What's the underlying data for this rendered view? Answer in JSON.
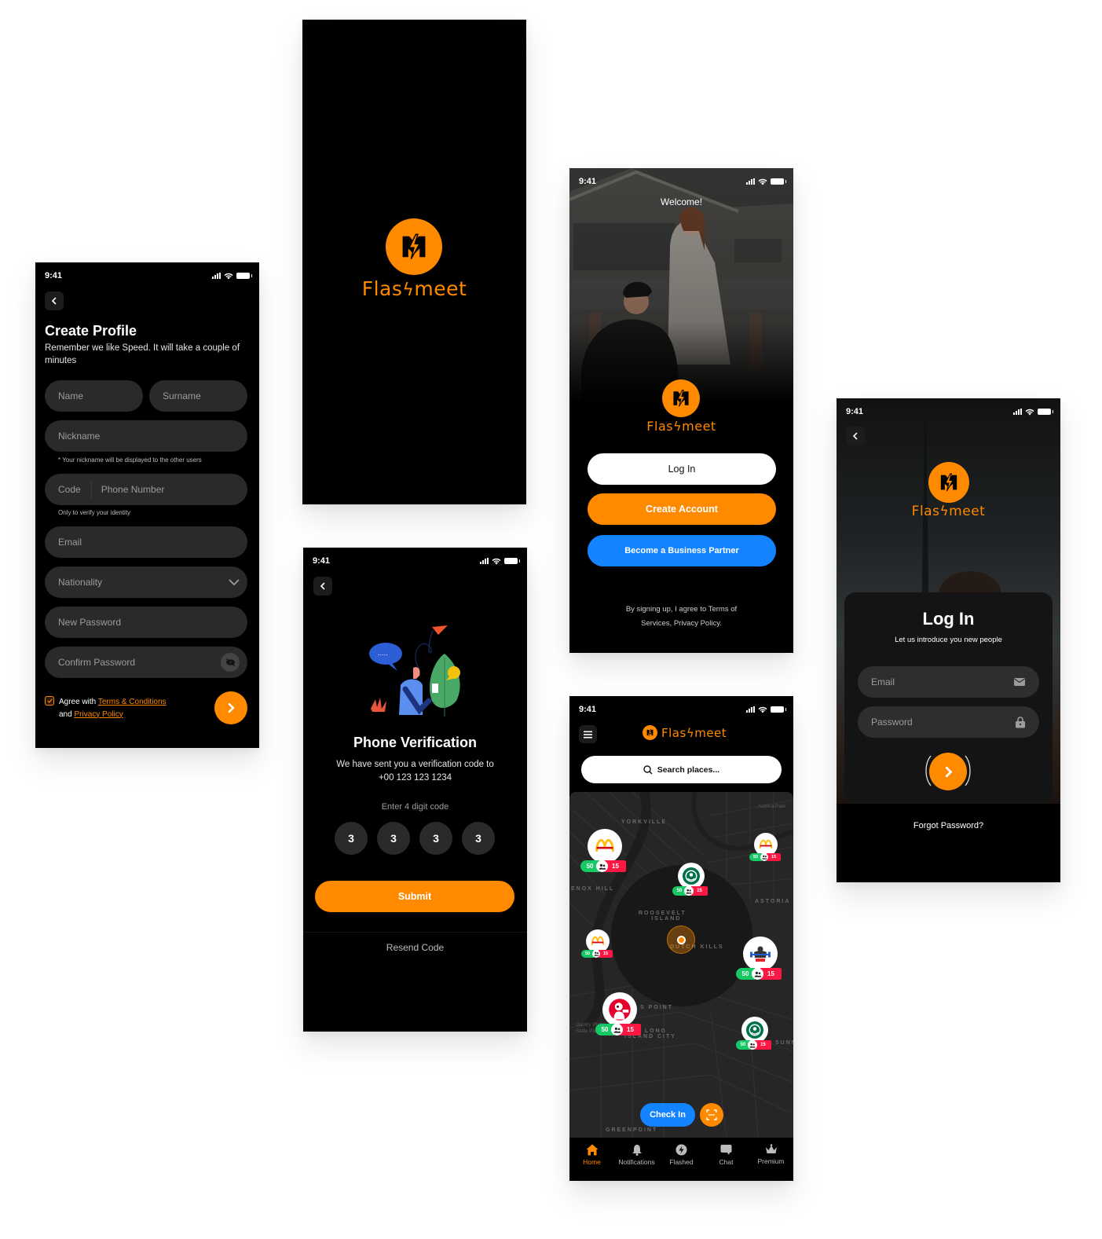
{
  "status": {
    "time": "9:41"
  },
  "brand": {
    "name": "Flashmeet",
    "name_part1": "Flas",
    "name_part2": "meet",
    "primary": "#FF8A00",
    "secondary": "#1483FF",
    "success": "#17C964",
    "danger": "#FF1744"
  },
  "create_profile": {
    "title": "Create Profile",
    "subtitle": "Remember we like Speed. It will take a couple of minutes",
    "fields": {
      "name": "Name",
      "surname": "Surname",
      "nickname": "Nickname",
      "nickname_hint": "* Your nickname will be displayed to the other users",
      "code": "Code",
      "phone": "Phone Number",
      "phone_hint": "Only to verify your identity",
      "email": "Email",
      "nationality": "Nationality",
      "new_password": "New Password",
      "confirm_password": "Confirm Password"
    },
    "agree_prefix": "Agree with ",
    "terms_link": "Terms & Conditions",
    "and": "and ",
    "privacy_link": "Privacy Policy",
    "agree_checked": true
  },
  "verification": {
    "title": "Phone Verification",
    "subtitle_line1": "We have sent you a verification code to",
    "phone": "+00 123 123 1234",
    "enter_label": "Enter 4 digit code",
    "digits": [
      "3",
      "3",
      "3",
      "3"
    ],
    "submit": "Submit",
    "resend": "Resend Code"
  },
  "welcome": {
    "greeting": "Welcome!",
    "login": "Log In",
    "create_account": "Create Account",
    "business": "Become a Business Partner",
    "terms_line1": "By signing up, I agree to Terms of",
    "terms_line2": "Services, Privacy Policy."
  },
  "map_screen": {
    "search_placeholder": "Search places...",
    "labels": {
      "yorkville": "YORKVILLE",
      "lenox_hill": "ENOX HILL",
      "roosevelt1": "ROOSEVELT",
      "roosevelt2": "ISLAND",
      "astoria": "ASTORIA",
      "astoria_park": "Astoria Park",
      "dutch_kills": "DUTCH KILLS",
      "hunters_point": "S POINT",
      "lic1": "LONG",
      "lic2": "ISLAND CITY",
      "gantry1": "Gantry Plaza",
      "gantry2": "State Park",
      "greenpoint": "GREENPOINT",
      "sunnyside": "SUNN"
    },
    "pins": [
      {
        "brand": "McDonald's",
        "left": "50",
        "right": "15"
      },
      {
        "brand": "McDonald's",
        "left": "50",
        "right": "15"
      },
      {
        "brand": "Starbucks",
        "left": "50",
        "right": "15"
      },
      {
        "brand": "McDonald's",
        "left": "50",
        "right": "15"
      },
      {
        "brand": "Gym",
        "left": "50",
        "right": "15"
      },
      {
        "brand": "KFC",
        "left": "50",
        "right": "15"
      },
      {
        "brand": "Starbucks",
        "left": "50",
        "right": "15"
      }
    ],
    "check_in": "Check In",
    "tabs": [
      {
        "label": "Home",
        "icon": "home-icon",
        "active": true
      },
      {
        "label": "Notifications",
        "icon": "bell-icon",
        "active": false
      },
      {
        "label": "Flashed",
        "icon": "flash-icon",
        "active": false
      },
      {
        "label": "Chat",
        "icon": "chat-icon",
        "active": false
      },
      {
        "label": "Premium",
        "icon": "crown-icon",
        "active": false
      }
    ]
  },
  "login": {
    "title": "Log In",
    "subtitle": "Let us introduce you new people",
    "email_placeholder": "Email",
    "password_placeholder": "Password",
    "forgot": "Forgot Password?"
  }
}
